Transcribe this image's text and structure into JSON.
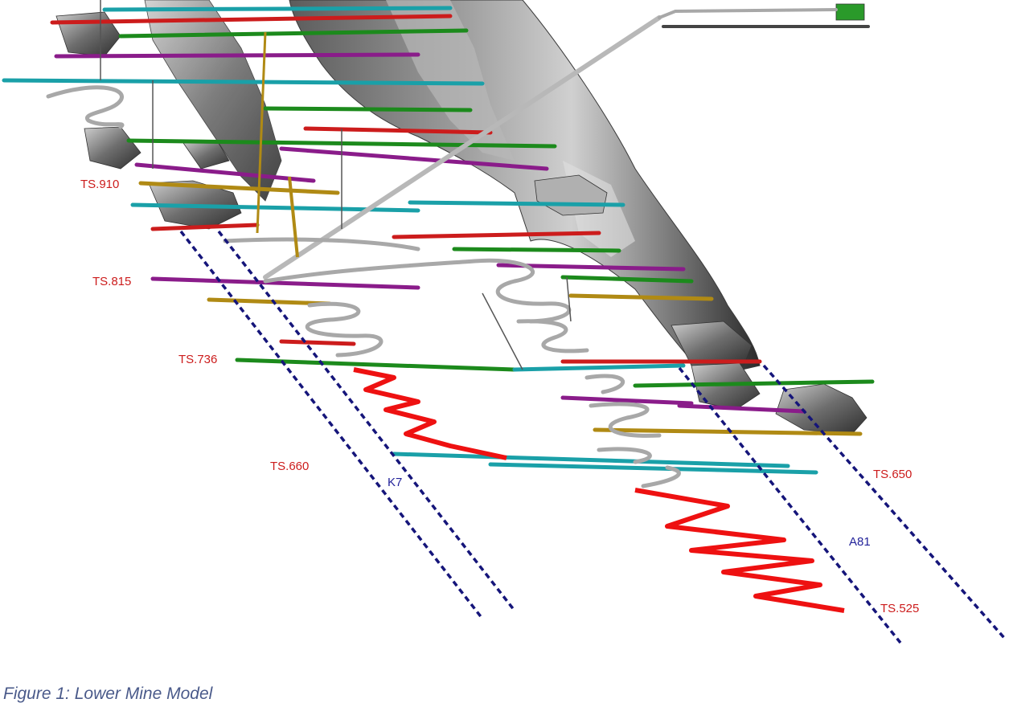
{
  "figure": {
    "caption": "Figure 1: Lower Mine Model",
    "level_labels": [
      "TS.910",
      "TS.815",
      "TS.736",
      "TS.660",
      "TS.650",
      "TS.525"
    ],
    "borehole_labels": [
      "K7",
      "A81"
    ]
  },
  "colors": {
    "level_red": "#cc1c1c",
    "borehole_blue": "#22229a",
    "orebody_grey": "#7a7a7a",
    "ramp_grey": "#a8a8a8",
    "new_ramp_red": "#ee1111",
    "drive_cyan": "#1aa0a8",
    "drive_green": "#1c8a1c",
    "drive_purple": "#8a1c8a",
    "drive_gold": "#b08a14",
    "caption": "#4a5a8a"
  }
}
